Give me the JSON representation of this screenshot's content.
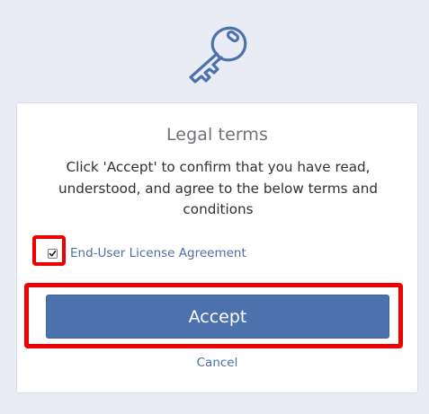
{
  "header": {
    "icon": "key-icon"
  },
  "dialog": {
    "title": "Legal terms",
    "description": "Click 'Accept' to confirm that you have read, understood, and agree to the below terms and conditions",
    "agreement": {
      "checked": true,
      "label": "End-User License Agreement"
    },
    "accept_label": "Accept",
    "cancel_label": "Cancel"
  },
  "colors": {
    "background": "#e9ecf4",
    "accent": "#4c71ad",
    "link": "#4c6ea6",
    "highlight": "#ee0000"
  }
}
